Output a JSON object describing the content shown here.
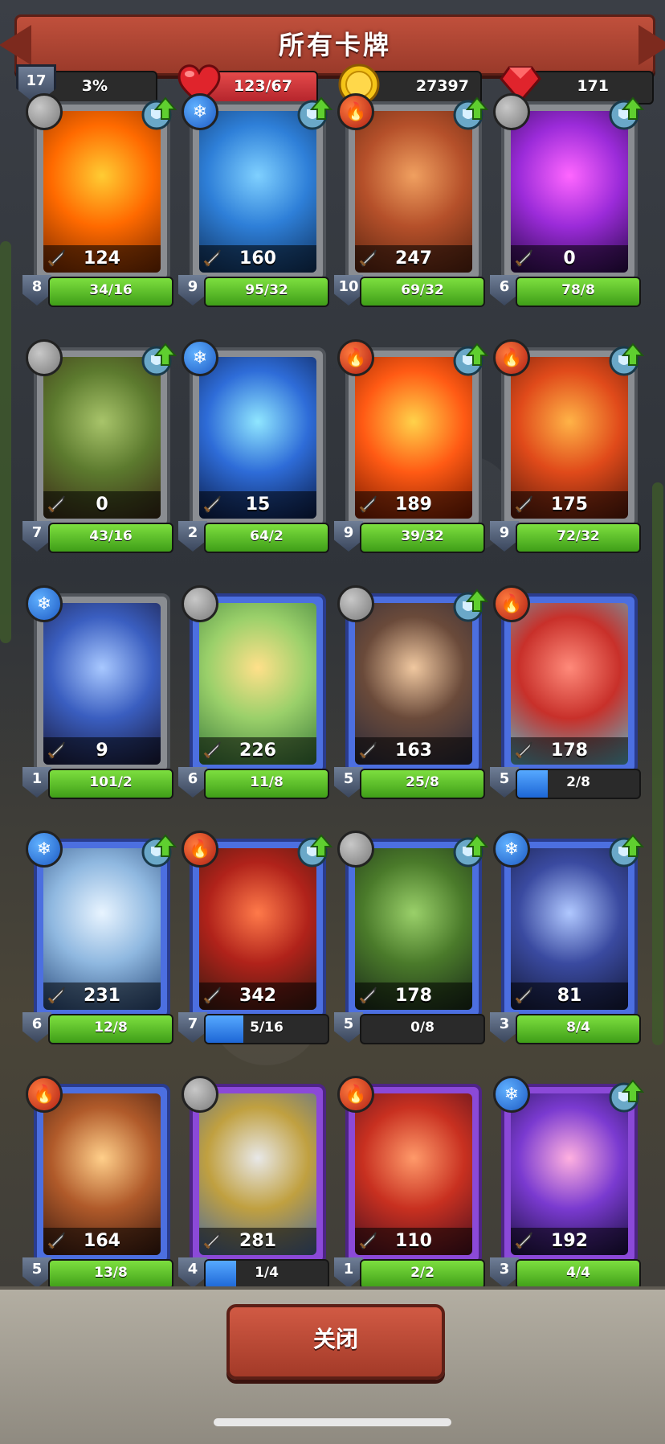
{
  "title": "所有卡牌",
  "resources": {
    "level": "17",
    "xp_percent": "3%",
    "hp": "123/67",
    "gold": "27397",
    "gems": "171"
  },
  "colors": {
    "fire": "#d4361f",
    "ice": "#2a7fe0",
    "stone": "#9a9a9a",
    "progress": "#5fc52a",
    "progress_partial": "#2d86ee"
  },
  "cards": [
    {
      "element": "stone",
      "frame": "gray",
      "power": "124",
      "level": "8",
      "progress": "34/16",
      "upgrade": true,
      "art": [
        "#ffcc33",
        "#ff6a00",
        "#7a2a00"
      ]
    },
    {
      "element": "ice",
      "frame": "gray",
      "power": "160",
      "level": "9",
      "progress": "95/32",
      "upgrade": true,
      "art": [
        "#7fd0ff",
        "#2e7fd8",
        "#10325e"
      ]
    },
    {
      "element": "fire",
      "frame": "gray",
      "power": "247",
      "level": "10",
      "progress": "69/32",
      "upgrade": true,
      "art": [
        "#f0a060",
        "#b5502a",
        "#5a2410"
      ]
    },
    {
      "element": "stone",
      "frame": "gray",
      "power": "0",
      "level": "6",
      "progress": "78/8",
      "upgrade": true,
      "art": [
        "#ff66ff",
        "#9b2bd9",
        "#2a0a4a"
      ]
    },
    {
      "element": "stone",
      "frame": "gray",
      "power": "0",
      "level": "7",
      "progress": "43/16",
      "upgrade": true,
      "art": [
        "#a8c46a",
        "#5c7a2e",
        "#3b2a18"
      ]
    },
    {
      "element": "ice",
      "frame": "gray",
      "power": "15",
      "level": "2",
      "progress": "64/2",
      "upgrade": false,
      "art": [
        "#8fe6ff",
        "#2e6cd8",
        "#0b1d4a"
      ]
    },
    {
      "element": "fire",
      "frame": "gray",
      "power": "189",
      "level": "9",
      "progress": "39/32",
      "upgrade": true,
      "art": [
        "#ffd24a",
        "#ff5a14",
        "#7a1a00"
      ]
    },
    {
      "element": "fire",
      "frame": "gray",
      "power": "175",
      "level": "9",
      "progress": "72/32",
      "upgrade": true,
      "art": [
        "#ffb347",
        "#e04a1a",
        "#5a1a0a"
      ]
    },
    {
      "element": "ice",
      "frame": "gray",
      "power": "9",
      "level": "1",
      "progress": "101/2",
      "upgrade": false,
      "art": [
        "#a8c8ff",
        "#3a5ec0",
        "#1a1a3a"
      ]
    },
    {
      "element": "stone",
      "frame": "blue",
      "power": "226",
      "level": "6",
      "progress": "11/8",
      "upgrade": false,
      "art": [
        "#ffe08a",
        "#9ad06a",
        "#3a7a3a"
      ]
    },
    {
      "element": "stone",
      "frame": "blue",
      "power": "163",
      "level": "5",
      "progress": "25/8",
      "upgrade": true,
      "art": [
        "#f0c8a0",
        "#6a4a3a",
        "#2a2a3a"
      ]
    },
    {
      "element": "fire",
      "frame": "blue",
      "power": "178",
      "level": "5",
      "progress": "2/8",
      "upgrade": false,
      "art": [
        "#ff8a7a",
        "#c8302a",
        "#5ab8c8"
      ]
    },
    {
      "element": "ice",
      "frame": "blue",
      "power": "231",
      "level": "6",
      "progress": "12/8",
      "upgrade": true,
      "art": [
        "#e8f4ff",
        "#8fb8e0",
        "#2a4a7a"
      ]
    },
    {
      "element": "fire",
      "frame": "blue",
      "power": "342",
      "level": "7",
      "progress": "5/16",
      "upgrade": true,
      "art": [
        "#ff7a4a",
        "#b0221a",
        "#3a1a10"
      ]
    },
    {
      "element": "stone",
      "frame": "blue",
      "power": "178",
      "level": "5",
      "progress": "0/8",
      "upgrade": true,
      "art": [
        "#9ad06a",
        "#4a7a2a",
        "#1a2a1a"
      ]
    },
    {
      "element": "ice",
      "frame": "blue",
      "power": "81",
      "level": "3",
      "progress": "8/4",
      "upgrade": true,
      "art": [
        "#b0c8ff",
        "#3a4aa0",
        "#141a3a"
      ]
    },
    {
      "element": "fire",
      "frame": "blue",
      "power": "164",
      "level": "5",
      "progress": "13/8",
      "upgrade": false,
      "art": [
        "#ffcf8a",
        "#b05a2a",
        "#3a1a10"
      ]
    },
    {
      "element": "stone",
      "frame": "purple",
      "power": "281",
      "level": "4",
      "progress": "1/4",
      "upgrade": false,
      "art": [
        "#e8e8e8",
        "#c0a040",
        "#4a6aa0"
      ]
    },
    {
      "element": "fire",
      "frame": "purple",
      "power": "110",
      "level": "1",
      "progress": "2/2",
      "upgrade": false,
      "art": [
        "#ff9a6a",
        "#c83020",
        "#4a1020"
      ]
    },
    {
      "element": "ice",
      "frame": "purple",
      "power": "192",
      "level": "3",
      "progress": "4/4",
      "upgrade": true,
      "art": [
        "#ffb0e0",
        "#7a3ad0",
        "#1a1040"
      ]
    }
  ],
  "progress_fill": [
    1,
    1,
    1,
    1,
    1,
    1,
    1,
    1,
    1,
    1,
    1,
    0.25,
    1,
    0.31,
    0,
    1,
    1,
    0.25,
    1,
    1
  ],
  "close_button": "关闭"
}
